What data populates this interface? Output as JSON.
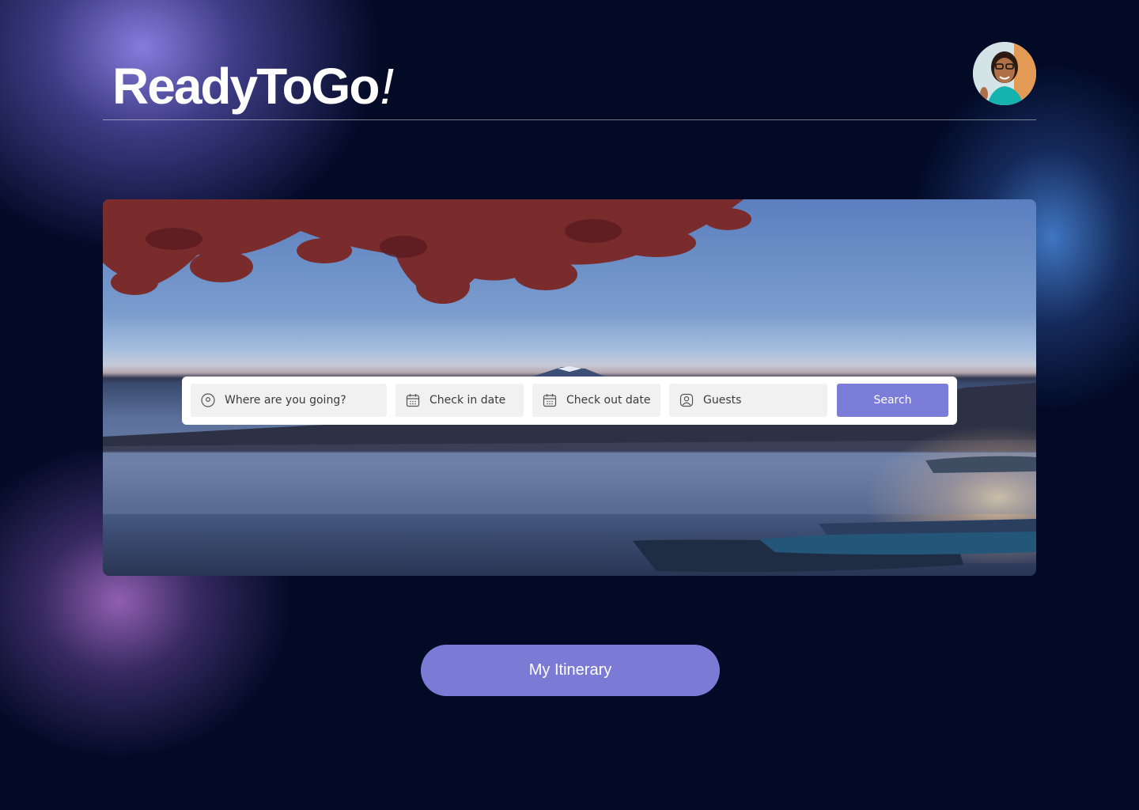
{
  "header": {
    "brand": "ReadyToGo",
    "brand_suffix": "!",
    "avatar_icon": "user-avatar-photo"
  },
  "hero": {
    "image_description_icon": "lake-mountain-landscape-image"
  },
  "search": {
    "destination_placeholder": "Where are you going?",
    "destination_icon": "location-pin-icon",
    "checkin_placeholder": "Check in date",
    "checkin_icon": "calendar-icon",
    "checkout_placeholder": "Check out date",
    "checkout_icon": "calendar-icon",
    "guests_placeholder": "Guests",
    "guests_icon": "user-icon",
    "button_label": "Search"
  },
  "itinerary": {
    "button_label": "My Itinerary"
  },
  "colors": {
    "background": "#020a26",
    "accent": "#7c7cd9",
    "field_bg": "#f1f1f1"
  }
}
